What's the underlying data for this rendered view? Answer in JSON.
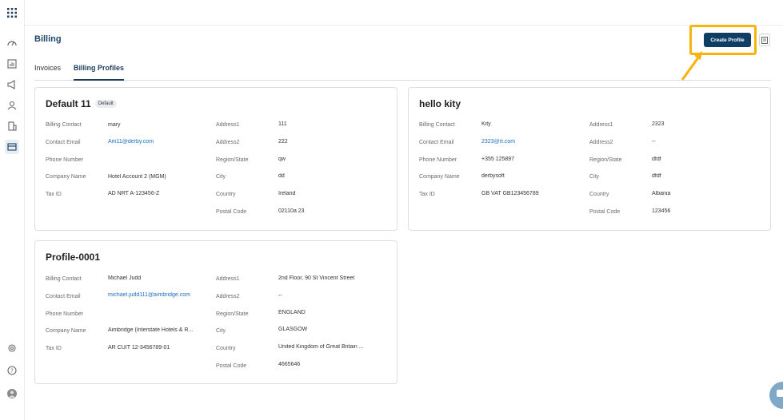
{
  "page": {
    "title": "Billing"
  },
  "tabs": [
    {
      "label": "Invoices",
      "active": false
    },
    {
      "label": "Billing Profiles",
      "active": true
    }
  ],
  "toolbar": {
    "create_label": "Create Profile"
  },
  "rail": {
    "icons": [
      "apps-grid-icon",
      "dashboard-icon",
      "analytics-icon",
      "announcement-icon",
      "users-icon",
      "building-icon",
      "billing-icon"
    ],
    "bottom_icons": [
      "settings-icon",
      "help-icon",
      "avatar"
    ]
  },
  "profiles": [
    {
      "name": "Default 11",
      "badge": "Default",
      "left": [
        {
          "label": "Billing Contact",
          "value": "mary"
        },
        {
          "label": "Contact Email",
          "value": "Am11@derby.com",
          "link": true
        },
        {
          "label": "Phone Number",
          "value": ""
        },
        {
          "label": "Company Name",
          "value": "Hotel Account 2 (MGM)"
        },
        {
          "label": "Tax ID",
          "value": "AD NRT A-123456-Z"
        }
      ],
      "right": [
        {
          "label": "Address1",
          "value": "111"
        },
        {
          "label": "Address2",
          "value": "222"
        },
        {
          "label": "Region/State",
          "value": "qw"
        },
        {
          "label": "City",
          "value": "dd"
        },
        {
          "label": "Country",
          "value": "Ireland"
        },
        {
          "label": "Postal Code",
          "value": "02110a 23"
        }
      ]
    },
    {
      "name": "hello kity",
      "badge": "",
      "left": [
        {
          "label": "Billing Contact",
          "value": "Kity"
        },
        {
          "label": "Contact Email",
          "value": "2323@rt.com",
          "link": true
        },
        {
          "label": "Phone Number",
          "value": "+355 125897"
        },
        {
          "label": "Company Name",
          "value": "derbysoft"
        },
        {
          "label": "Tax ID",
          "value": "GB VAT GB123456789"
        }
      ],
      "right": [
        {
          "label": "Address1",
          "value": "2323"
        },
        {
          "label": "Address2",
          "value": "--"
        },
        {
          "label": "Region/State",
          "value": "dfdf"
        },
        {
          "label": "City",
          "value": "dfdf"
        },
        {
          "label": "Country",
          "value": "Albania"
        },
        {
          "label": "Postal Code",
          "value": "123456"
        }
      ]
    },
    {
      "name": "Profile-0001",
      "badge": "",
      "left": [
        {
          "label": "Billing Contact",
          "value": "Michael Judd"
        },
        {
          "label": "Contact Email",
          "value": "michael.judd111@aimbridge.com",
          "link": true
        },
        {
          "label": "Phone Number",
          "value": ""
        },
        {
          "label": "Company Name",
          "value": "Aimbridge (Interstate Hotels & R..."
        },
        {
          "label": "Tax ID",
          "value": "AR CUIT 12-3456789-01"
        }
      ],
      "right": [
        {
          "label": "Address1",
          "value": "2nd Floor, 90 St Vincent Street"
        },
        {
          "label": "Address2",
          "value": "--"
        },
        {
          "label": "Region/State",
          "value": "ENGLAND"
        },
        {
          "label": "City",
          "value": "GLASGOW"
        },
        {
          "label": "Country",
          "value": "United Kingdom of Great Britain ..."
        },
        {
          "label": "Postal Code",
          "value": "4665646"
        }
      ]
    }
  ],
  "colors": {
    "primary": "#0f3d63",
    "highlight": "#f6b40d",
    "link": "#1a6ec1"
  }
}
